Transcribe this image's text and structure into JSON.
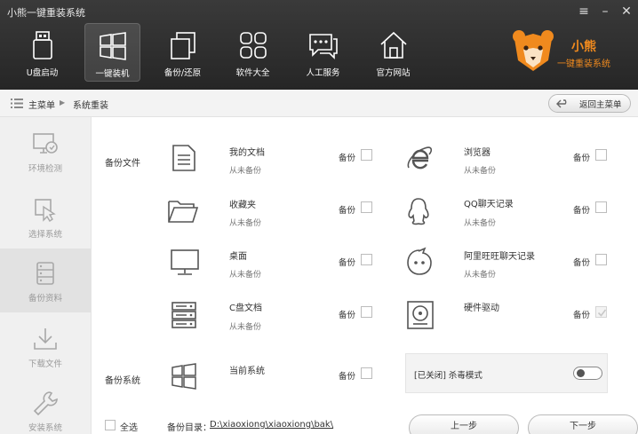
{
  "window": {
    "title": "小熊一键重装系统",
    "menu_icon": "hamburger-icon",
    "minimize_icon": "minimize-icon",
    "close_icon": "close-icon"
  },
  "nav": [
    {
      "label": "U盘启动",
      "icon": "usb-drive-icon"
    },
    {
      "label": "一键装机",
      "icon": "windows-icon",
      "active": true
    },
    {
      "label": "备份/还原",
      "icon": "backup-restore-icon"
    },
    {
      "label": "软件大全",
      "icon": "apps-grid-icon"
    },
    {
      "label": "人工服务",
      "icon": "chat-icon"
    },
    {
      "label": "官方网站",
      "icon": "home-icon"
    }
  ],
  "brand": {
    "name": "小熊",
    "tagline": "一键重装系统",
    "accent": "#f08a1e"
  },
  "breadcrumb": {
    "root": "主菜单",
    "current": "系统重装",
    "back_label": "返回主菜单"
  },
  "sidebar": [
    {
      "label": "环境检测",
      "icon": "monitor-check-icon"
    },
    {
      "label": "选择系统",
      "icon": "cursor-select-icon"
    },
    {
      "label": "备份资料",
      "icon": "database-icon",
      "active": true
    },
    {
      "label": "下载文件",
      "icon": "download-icon"
    },
    {
      "label": "安装系统",
      "icon": "wrench-icon"
    }
  ],
  "backup_files": {
    "section_label": "备份文件",
    "backup_label": "备份",
    "left": [
      {
        "name": "我的文档",
        "status": "从未备份",
        "icon": "document-icon"
      },
      {
        "name": "收藏夹",
        "status": "从未备份",
        "icon": "folder-icon"
      },
      {
        "name": "桌面",
        "status": "从未备份",
        "icon": "desktop-monitor-icon"
      },
      {
        "name": "C盘文档",
        "status": "从未备份",
        "icon": "server-drive-icon"
      }
    ],
    "right": [
      {
        "name": "浏览器",
        "status": "从未备份",
        "icon": "ie-browser-icon"
      },
      {
        "name": "QQ聊天记录",
        "status": "从未备份",
        "icon": "qq-penguin-icon"
      },
      {
        "name": "阿里旺旺聊天记录",
        "status": "从未备份",
        "icon": "aliwangwang-icon"
      },
      {
        "name": "硬件驱动",
        "status": "",
        "icon": "hard-disk-icon",
        "disabled": true
      }
    ]
  },
  "backup_system": {
    "section_label": "备份系统",
    "name": "当前系统",
    "backup_label": "备份",
    "icon": "windows-icon"
  },
  "kill_mode": {
    "label": "[已关闭] 杀毒模式",
    "enabled": false
  },
  "footer": {
    "select_all": "全选",
    "dir_label": "备份目录：",
    "dir_path": "D:\\xiaoxiong\\xiaoxiong\\bak\\",
    "prev_label": "上一步",
    "next_label": "下一步"
  }
}
